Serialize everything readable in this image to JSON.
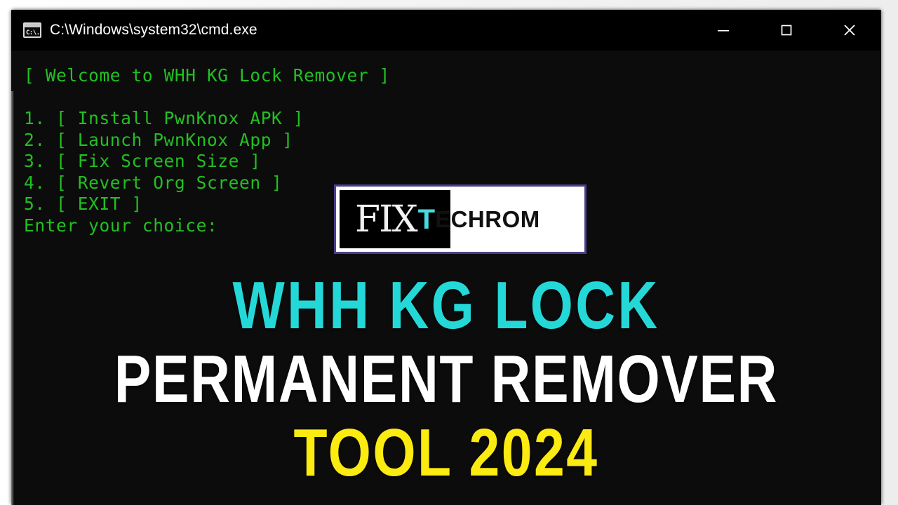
{
  "window": {
    "title": "C:\\Windows\\system32\\cmd.exe",
    "icon_label": "C:\\.",
    "icon_name": "cmd-icon",
    "controls": {
      "minimize": "minimize-icon",
      "maximize": "maximize-icon",
      "close": "close-icon"
    }
  },
  "console": {
    "foreground_color": "#22c022",
    "background_color": "#0c0c0c",
    "lines": [
      "[ Welcome to WHH KG Lock Remover ]",
      "",
      "1. [ Install PwnKnox APK ]",
      "2. [ Launch PwnKnox App ]",
      "3. [ Fix Screen Size ]",
      "4. [ Revert Org Screen ]",
      "5. [ EXIT ]",
      "Enter your choice:"
    ],
    "text": "[ Welcome to WHH KG Lock Remover ]\n\n1. [ Install PwnKnox APK ]\n2. [ Launch PwnKnox App ]\n3. [ Fix Screen Size ]\n4. [ Revert Org Screen ]\n5. [ EXIT ]\nEnter your choice:",
    "menu_items": [
      {
        "number": "1.",
        "label": "[ Install PwnKnox APK ]"
      },
      {
        "number": "2.",
        "label": "[ Launch PwnKnox App ]"
      },
      {
        "number": "3.",
        "label": "[ Fix Screen Size ]"
      },
      {
        "number": "4.",
        "label": "[ Revert Org Screen ]"
      },
      {
        "number": "5.",
        "label": "[ EXIT ]"
      }
    ],
    "prompt": "Enter your choice:"
  },
  "logo": {
    "fix": "FIX",
    "t": "T",
    "rest": "ECHROM",
    "full_text": "FIXTECHROM",
    "accent_color": "#4ad8e0",
    "border_color": "#4b3f8f"
  },
  "headline": {
    "line1": "WHH KG LOCK",
    "line2": "PERMANENT REMOVER",
    "line3": "TOOL 2024",
    "line1_color": "#25D8D8",
    "line2_color": "#FFFFFF",
    "line3_color": "#FBEB10"
  }
}
